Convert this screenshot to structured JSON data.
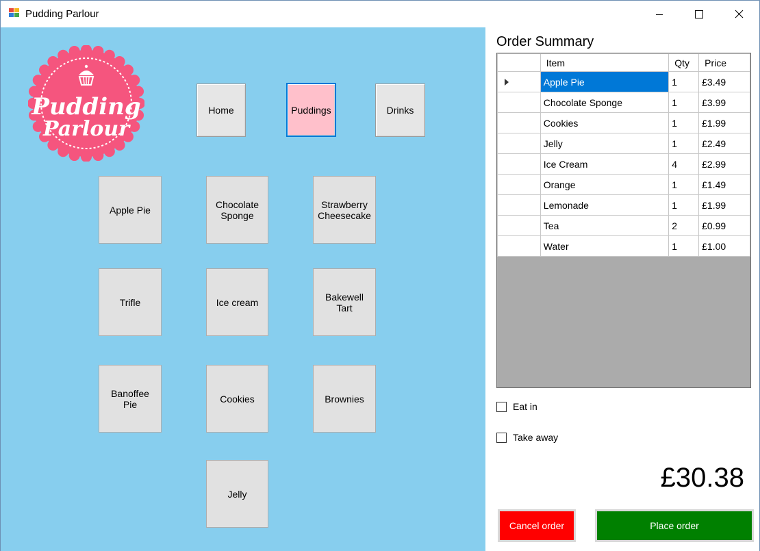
{
  "window": {
    "title": "Pudding Parlour"
  },
  "logo": {
    "line1": "Pudding",
    "line2": "Parlour",
    "color": "#f5557e"
  },
  "nav": [
    {
      "label": "Home",
      "active": false
    },
    {
      "label": "Puddings",
      "active": true
    },
    {
      "label": "Drinks",
      "active": false
    }
  ],
  "products": [
    {
      "label": "Apple Pie"
    },
    {
      "label": "Chocolate\nSponge"
    },
    {
      "label": "Strawberry\nCheesecake"
    },
    {
      "label": "Trifle"
    },
    {
      "label": "Ice cream"
    },
    {
      "label": "Bakewell\nTart"
    },
    {
      "label": "Banoffee\nPie"
    },
    {
      "label": "Cookies"
    },
    {
      "label": "Brownies"
    },
    {
      "label": "Jelly"
    }
  ],
  "order": {
    "title": "Order Summary",
    "columns": {
      "item": "Item",
      "qty": "Qty",
      "price": "Price"
    },
    "rows": [
      {
        "item": "Apple Pie",
        "qty": "1",
        "price": "£3.49",
        "selected": true
      },
      {
        "item": "Chocolate Sponge",
        "qty": "1",
        "price": "£3.99"
      },
      {
        "item": "Cookies",
        "qty": "1",
        "price": "£1.99"
      },
      {
        "item": "Jelly",
        "qty": "1",
        "price": "£2.49"
      },
      {
        "item": "Ice Cream",
        "qty": "4",
        "price": "£2.99"
      },
      {
        "item": "Orange",
        "qty": "1",
        "price": "£1.49"
      },
      {
        "item": "Lemonade",
        "qty": "1",
        "price": "£1.99"
      },
      {
        "item": "Tea",
        "qty": "2",
        "price": "£0.99"
      },
      {
        "item": "Water",
        "qty": "1",
        "price": "£1.00"
      }
    ],
    "eat_in_label": "Eat in",
    "take_away_label": "Take away",
    "total": "£30.38",
    "cancel_label": "Cancel order",
    "place_label": "Place order"
  },
  "colors": {
    "menu_background": "#87ceee",
    "active_tab": "#ffc0cb",
    "selection": "#0078d7",
    "cancel": "#ff0000",
    "place": "#008000"
  }
}
